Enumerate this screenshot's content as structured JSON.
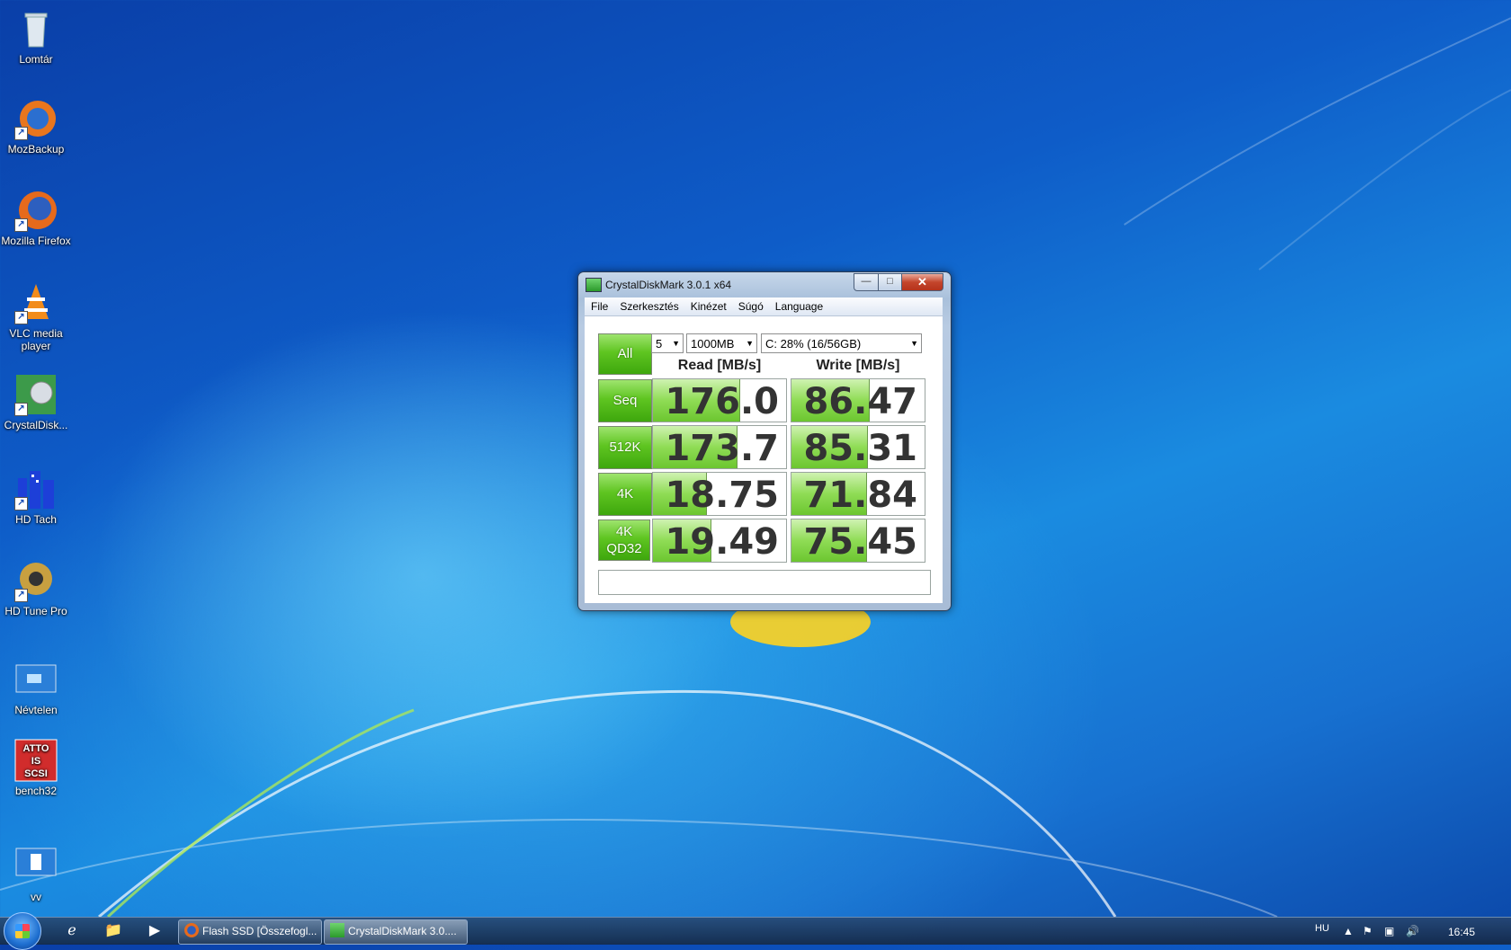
{
  "desktop": {
    "icons": [
      {
        "label": "Lomtár",
        "icon": "recycle-bin-icon"
      },
      {
        "label": "MozBackup",
        "icon": "mozbackup-icon"
      },
      {
        "label": "Mozilla Firefox",
        "icon": "firefox-icon"
      },
      {
        "label": "VLC media player",
        "icon": "vlc-icon"
      },
      {
        "label": "CrystalDisk...",
        "icon": "crystaldisk-icon"
      },
      {
        "label": "HD Tach",
        "icon": "hdtach-icon"
      },
      {
        "label": "HD Tune Pro",
        "icon": "hdtune-icon"
      },
      {
        "label": "Névtelen",
        "icon": "nevtelen-icon"
      },
      {
        "label": "bench32",
        "icon": "atto-icon",
        "logo_text": "ATTO IS SCSI"
      },
      {
        "label": "vv",
        "icon": "vv-icon"
      }
    ]
  },
  "window": {
    "title": "CrystalDiskMark 3.0.1 x64",
    "menu": [
      "File",
      "Szerkesztés",
      "Kinézet",
      "Súgó",
      "Language"
    ],
    "controls": {
      "all_label": "All",
      "count": "5",
      "size": "1000MB",
      "drive": "C: 28% (16/56GB)"
    },
    "read_header": "Read [MB/s]",
    "write_header": "Write [MB/s]",
    "rows": [
      {
        "label": "Seq",
        "read": "176.0",
        "write": "86.47",
        "read_fill": 0.65,
        "write_fill": 0.58
      },
      {
        "label": "512K",
        "read": "173.7",
        "write": "85.31",
        "read_fill": 0.63,
        "write_fill": 0.57
      },
      {
        "label": "4K",
        "read": "18.75",
        "write": "71.84",
        "read_fill": 0.4,
        "write_fill": 0.56
      },
      {
        "label": "4K\nQD32",
        "label_line1": "4K",
        "label_line2": "QD32",
        "read": "19.49",
        "write": "75.45",
        "read_fill": 0.43,
        "write_fill": 0.56
      }
    ],
    "status": ""
  },
  "taskbar": {
    "tasks": [
      {
        "label": "Flash SSD [Összefogl...",
        "icon": "firefox-icon"
      },
      {
        "label": "CrystalDiskMark 3.0....",
        "icon": "crystaldisk-icon"
      }
    ],
    "language": "HU",
    "clock": "16:45"
  },
  "colors": {
    "accent_green": "#5fc521",
    "bar_green": "#8fdc55",
    "desktop_blue": "#1a8be0"
  }
}
